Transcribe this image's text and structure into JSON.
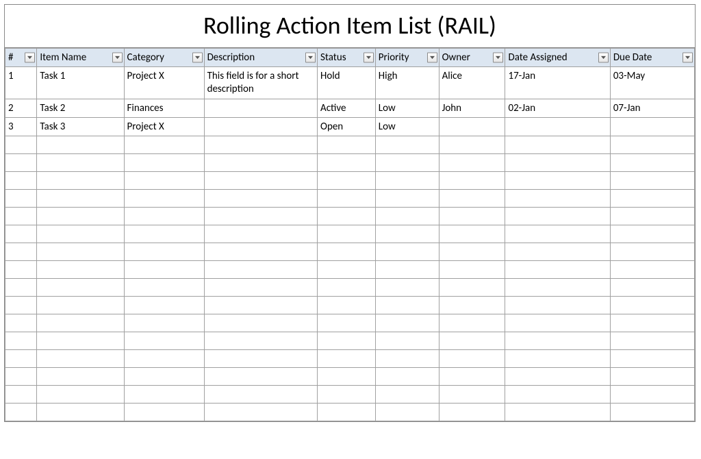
{
  "title": "Rolling Action Item List (RAIL)",
  "columns": [
    {
      "key": "num",
      "label": "#"
    },
    {
      "key": "name",
      "label": "Item Name"
    },
    {
      "key": "category",
      "label": "Category"
    },
    {
      "key": "description",
      "label": "Description"
    },
    {
      "key": "status",
      "label": "Status"
    },
    {
      "key": "priority",
      "label": "Priority"
    },
    {
      "key": "owner",
      "label": "Owner"
    },
    {
      "key": "assigned",
      "label": "Date Assigned"
    },
    {
      "key": "due",
      "label": "Due Date"
    }
  ],
  "rows": [
    {
      "num": "1",
      "name": "Task 1",
      "category": "Project X",
      "description": "This field is for a short description",
      "status": "Hold",
      "priority": "High",
      "owner": "Alice",
      "assigned": "17-Jan",
      "due": "03-May"
    },
    {
      "num": "2",
      "name": "Task 2",
      "category": "Finances",
      "description": "",
      "status": "Active",
      "priority": "Low",
      "owner": "John",
      "assigned": "02-Jan",
      "due": "07-Jan"
    },
    {
      "num": "3",
      "name": "Task 3",
      "category": "Project X",
      "description": "",
      "status": "Open",
      "priority": "Low",
      "owner": "",
      "assigned": "",
      "due": ""
    }
  ],
  "emptyRows": 16
}
